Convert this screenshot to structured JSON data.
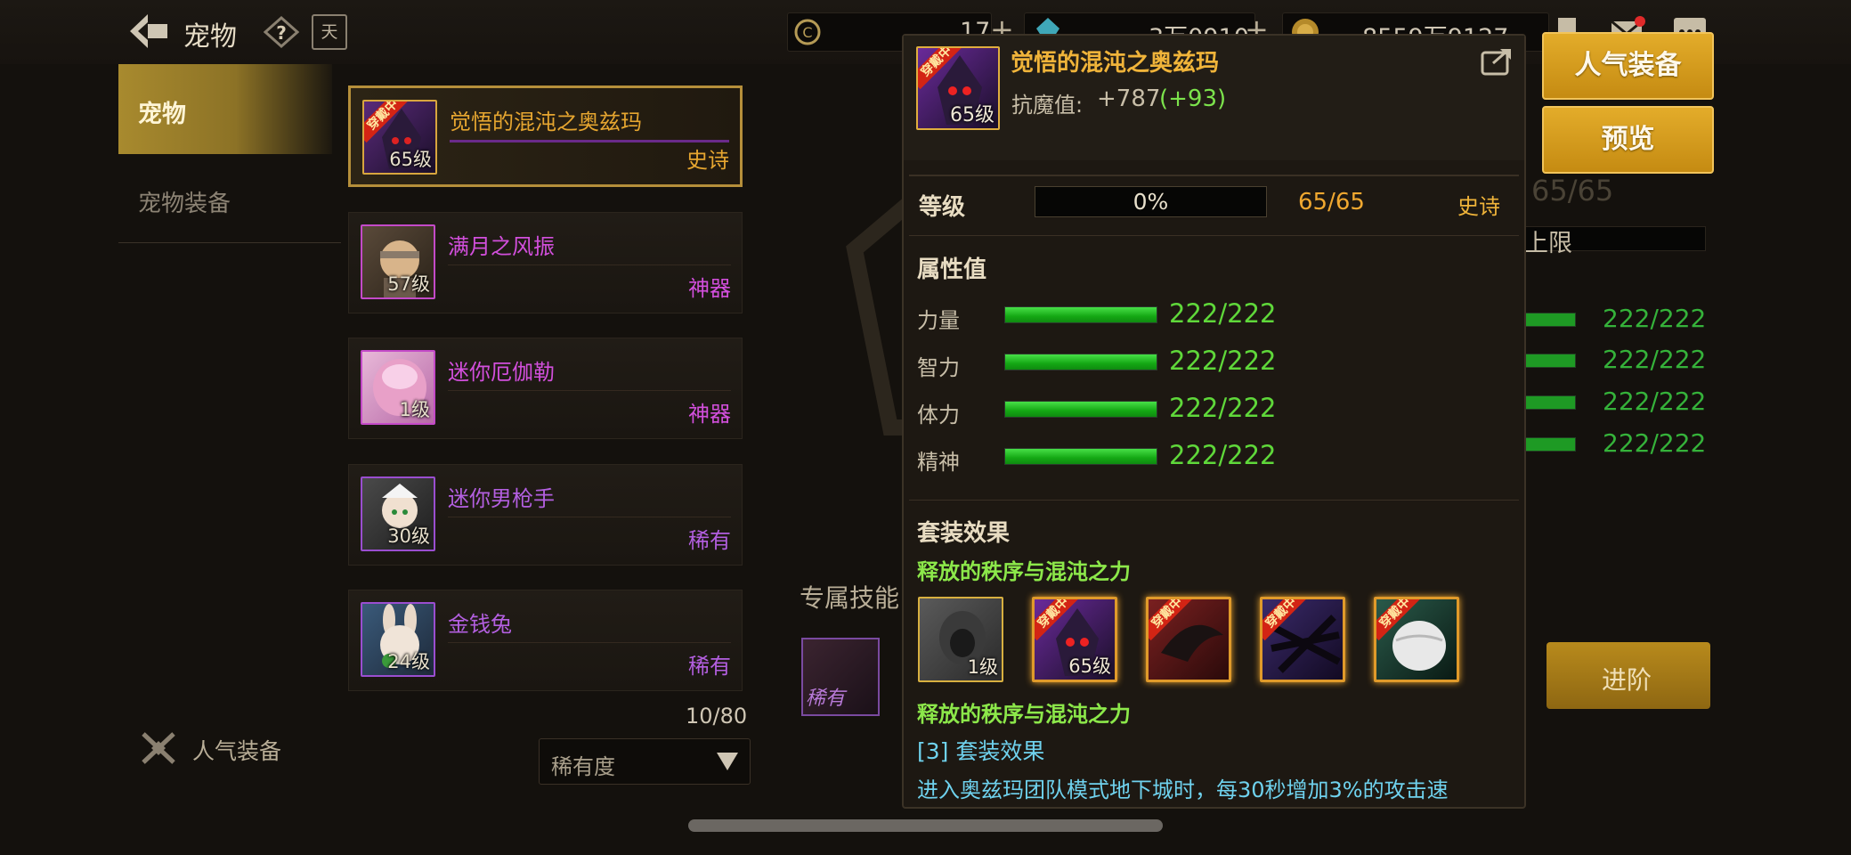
{
  "header": {
    "title": "宠物",
    "help_icon": "?",
    "calendar_icon_label": "天",
    "resources": [
      {
        "icon": "coin-c-icon",
        "value": "17"
      },
      {
        "icon": "crystal-icon",
        "value": "3万0910"
      },
      {
        "icon": "gold-icon",
        "value": "8559万9127"
      }
    ]
  },
  "nav": {
    "items": [
      {
        "label": "宠物",
        "active": true
      },
      {
        "label": "宠物装备",
        "active": false
      }
    ],
    "popular_label": "人气装备"
  },
  "pets": [
    {
      "name": "觉悟的混沌之奥兹玛",
      "level": "65级",
      "rarity": "史诗",
      "name_color": "#e6a630",
      "rarity_color": "#e6a630",
      "wearing": true,
      "wear_label": "穿戴中"
    },
    {
      "name": "满月之风振",
      "level": "57级",
      "rarity": "神器",
      "name_color": "#d24fdc",
      "rarity_color": "#d24fdc"
    },
    {
      "name": "迷你厄伽勒",
      "level": "1级",
      "rarity": "神器",
      "name_color": "#d24fdc",
      "rarity_color": "#d24fdc"
    },
    {
      "name": "迷你男枪手",
      "level": "30级",
      "rarity": "稀有",
      "name_color": "#b35fe0",
      "rarity_color": "#b35fe0"
    },
    {
      "name": "金钱兔",
      "level": "24级",
      "rarity": "稀有",
      "name_color": "#b35fe0",
      "rarity_color": "#b35fe0"
    }
  ],
  "list_count": "10/80",
  "sort_select": {
    "value": "稀有度"
  },
  "background_panel": {
    "skill_title": "专属技能",
    "skill_rarity": "稀有",
    "level_text": "65/65",
    "limit_label": "上限",
    "stat_values": [
      "222/222",
      "222/222",
      "222/222",
      "222/222"
    ],
    "advance_label": "进阶"
  },
  "right_buttons": {
    "popular": "人气装备",
    "preview": "预览"
  },
  "popup": {
    "title": "觉悟的混沌之奥兹玛",
    "icon_level": "65级",
    "wear_label": "穿戴中",
    "resist_label": "抗魔值:",
    "resist_value": "+787",
    "resist_bonus": "(+93)",
    "level_label": "等级",
    "level_percent": "0%",
    "level_progress": 0,
    "level_value": "65/65",
    "level_rarity": "史诗",
    "attr_title": "属性值",
    "stats": [
      {
        "name": "力量",
        "value": "222/222",
        "fill": 1.0
      },
      {
        "name": "智力",
        "value": "222/222",
        "fill": 1.0
      },
      {
        "name": "体力",
        "value": "222/222",
        "fill": 1.0
      },
      {
        "name": "精神",
        "value": "222/222",
        "fill": 1.0
      }
    ],
    "set_title": "套装效果",
    "set_name": "释放的秩序与混沌之力",
    "set_items": [
      {
        "level": "1级",
        "wearing": false
      },
      {
        "level": "65级",
        "wearing": true
      },
      {
        "level": "",
        "wearing": true
      },
      {
        "level": "",
        "wearing": true
      },
      {
        "level": "",
        "wearing": true
      }
    ],
    "set_name_2": "释放的秩序与混沌之力",
    "set_count": "[3] 套装效果",
    "set_desc": "进入奥兹玛团队模式地下城时，每30秒增加3%的攻击速"
  },
  "colors": {
    "accent_gold": "#e3ac2a",
    "stat_green": "#5fd83a",
    "set_green": "#8ce84a",
    "desc_blue": "#6fd2ee"
  }
}
